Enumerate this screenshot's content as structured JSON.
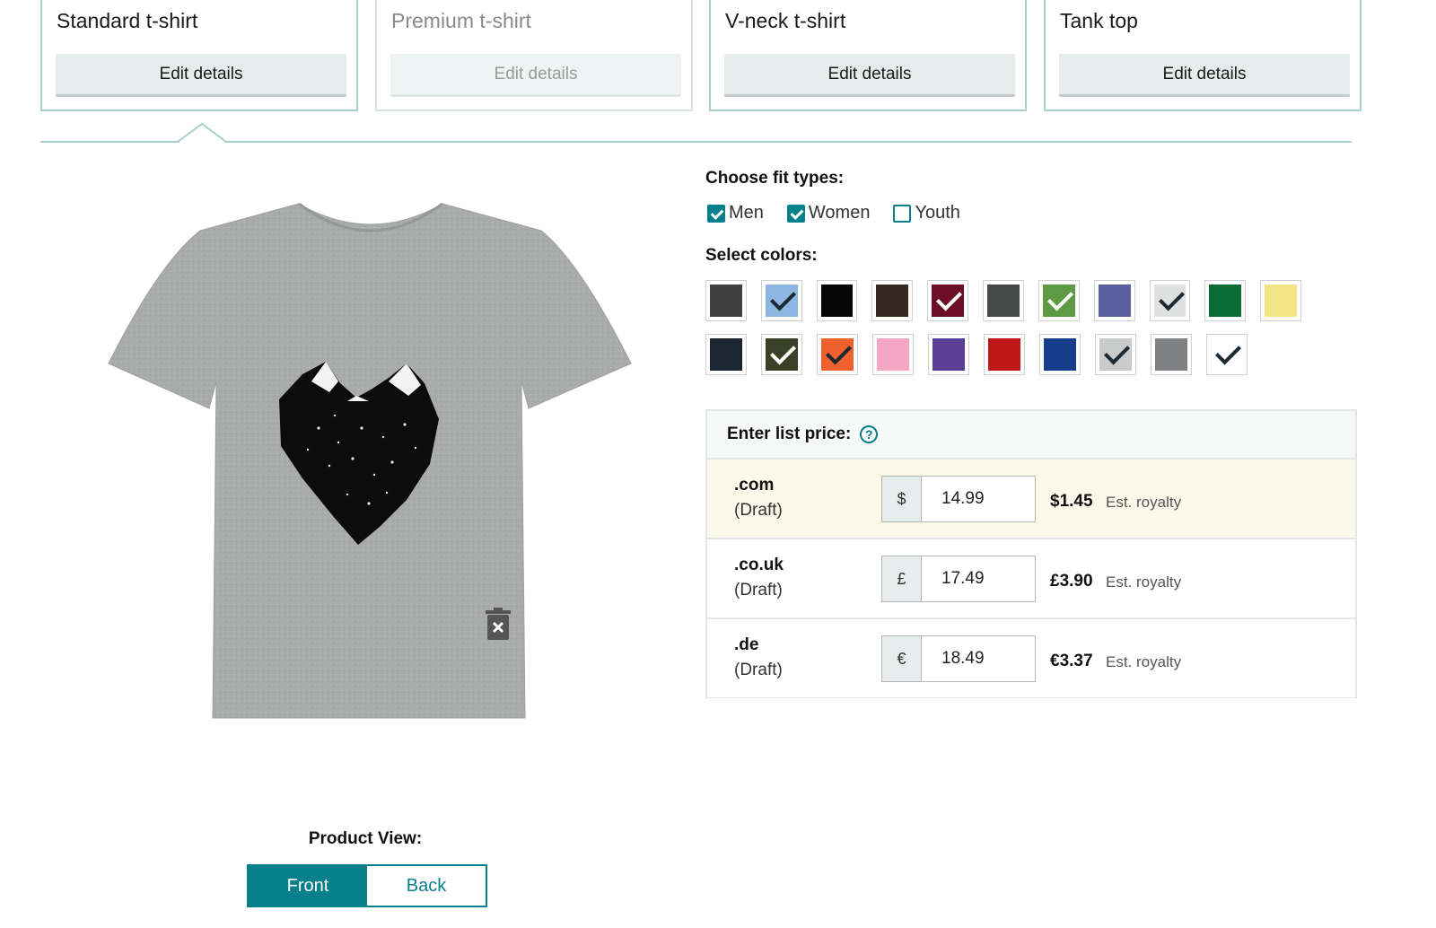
{
  "products": [
    {
      "title": "Standard t-shirt",
      "button": "Edit details",
      "state": "selected"
    },
    {
      "title": "Premium t-shirt",
      "button": "Edit details",
      "state": "disabled"
    },
    {
      "title": "V-neck t-shirt",
      "button": "Edit details",
      "state": "enabled"
    },
    {
      "title": "Tank top",
      "button": "Edit details",
      "state": "enabled"
    }
  ],
  "fit": {
    "heading": "Choose fit types:",
    "options": [
      {
        "label": "Men",
        "checked": true
      },
      {
        "label": "Women",
        "checked": true
      },
      {
        "label": "Youth",
        "checked": false
      }
    ]
  },
  "colors": {
    "heading": "Select colors:",
    "swatches": [
      {
        "name": "asphalt",
        "hex": "#3f3f3f",
        "selected": false
      },
      {
        "name": "baby-blue",
        "hex": "#8db5e2",
        "selected": true,
        "check": "#1d2a33"
      },
      {
        "name": "black",
        "hex": "#050505",
        "selected": false
      },
      {
        "name": "brown",
        "hex": "#352a20",
        "selected": false
      },
      {
        "name": "cranberry",
        "hex": "#6c0e26",
        "selected": true,
        "check": "#ffffff"
      },
      {
        "name": "dark-heather",
        "hex": "#454a48",
        "selected": false
      },
      {
        "name": "grass",
        "hex": "#5c9b44",
        "selected": true,
        "check": "#ffffff"
      },
      {
        "name": "heather-blue",
        "hex": "#5a5fa0",
        "selected": false
      },
      {
        "name": "heather-grey",
        "hex": "#dfe1e1",
        "selected": true,
        "check": "#1d2a33"
      },
      {
        "name": "kelly-green",
        "hex": "#0b6b34",
        "selected": false
      },
      {
        "name": "lemon",
        "hex": "#f1e683",
        "selected": false
      },
      {
        "name": "navy",
        "hex": "#1a2631",
        "selected": false
      },
      {
        "name": "olive",
        "hex": "#3b4127",
        "selected": true,
        "check": "#ffffff"
      },
      {
        "name": "orange",
        "hex": "#f0612e",
        "selected": true,
        "check": "#1d2a33"
      },
      {
        "name": "pink",
        "hex": "#f4a6c3",
        "selected": false
      },
      {
        "name": "purple",
        "hex": "#5a3e95",
        "selected": false
      },
      {
        "name": "red",
        "hex": "#c01818",
        "selected": false
      },
      {
        "name": "royal-blue",
        "hex": "#173e8c",
        "selected": false
      },
      {
        "name": "silver",
        "hex": "#c9cbcb",
        "selected": true,
        "check": "#1d2a33"
      },
      {
        "name": "slate",
        "hex": "#7e8084",
        "selected": false
      },
      {
        "name": "white",
        "hex": "#ffffff",
        "selected": true,
        "check": "#1d2a33"
      }
    ]
  },
  "pricing": {
    "heading": "Enter list price:",
    "help_icon": "question-circle-icon",
    "rows": [
      {
        "market": ".com",
        "status": "(Draft)",
        "currency": "$",
        "price": "14.99",
        "royalty": "$1.45",
        "royalty_label": "Est. royalty",
        "active": true
      },
      {
        "market": ".co.uk",
        "status": "(Draft)",
        "currency": "£",
        "price": "17.49",
        "royalty": "£3.90",
        "royalty_label": "Est. royalty",
        "active": false
      },
      {
        "market": ".de",
        "status": "(Draft)",
        "currency": "€",
        "price": "18.49",
        "royalty": "€3.37",
        "royalty_label": "Est. royalty",
        "active": false
      }
    ]
  },
  "product_view": {
    "label": "Product View:",
    "front": "Front",
    "back": "Back",
    "selected": "Front"
  },
  "theme": {
    "accent": "#08808c",
    "shirt_color": "#a9abab"
  }
}
